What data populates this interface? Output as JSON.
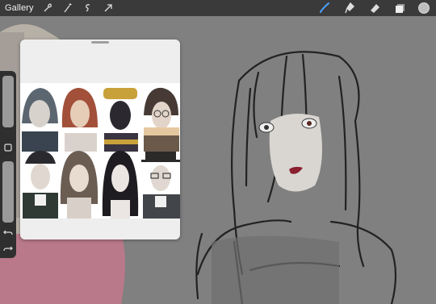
{
  "toolbar": {
    "gallery_label": "Gallery",
    "left_icons": [
      "wrench-icon",
      "magic-wand-icon",
      "selection-icon",
      "transform-arrow-icon"
    ],
    "right_tools": [
      "brush-icon",
      "smudge-icon",
      "eraser-icon",
      "layers-icon",
      "color-swatch"
    ],
    "active_color": "#bdbdbd",
    "brush_active_color": "#4aa3ff"
  },
  "sidebar": {
    "buttons": [
      "modify-square-icon",
      "undo-icon",
      "redo-icon"
    ]
  },
  "reference": {
    "portrait_count": 8
  }
}
